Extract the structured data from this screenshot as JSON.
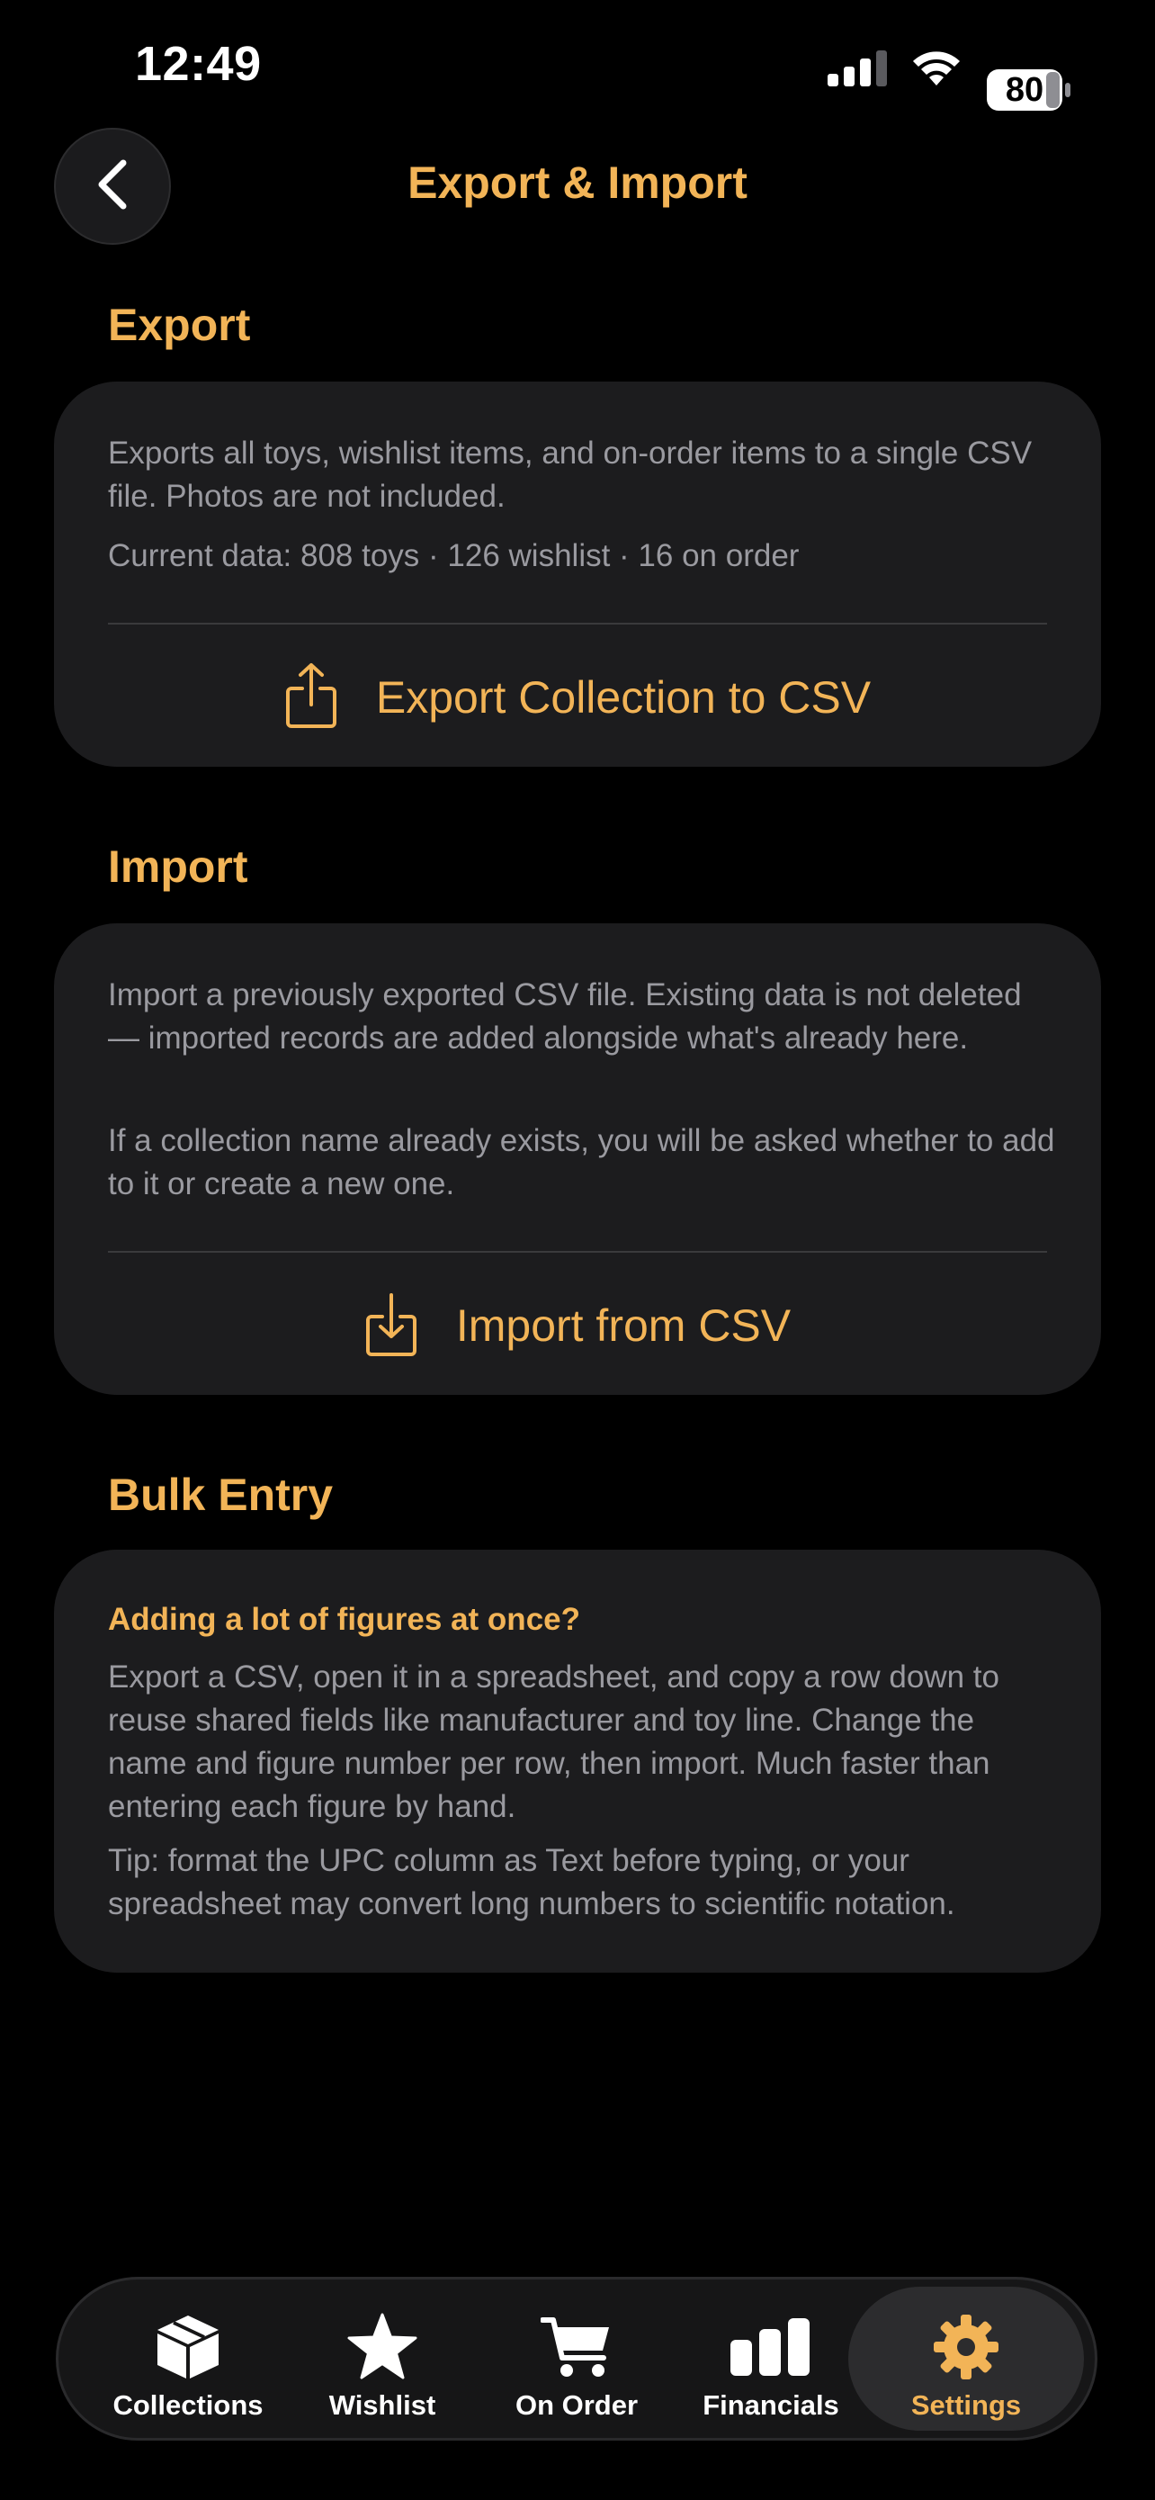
{
  "status_bar": {
    "time": "12:49",
    "battery": "80"
  },
  "header": {
    "title": "Export & Import"
  },
  "colors": {
    "accent": "#f2b457",
    "background": "#000000",
    "card": "#1c1c1e",
    "secondary_text": "#9a9aa0"
  },
  "export": {
    "heading": "Export",
    "description": "Exports all toys, wishlist items, and on-order items to a single CSV file. Photos are not included.",
    "current_data": "Current data: 808 toys · 126 wishlist · 16 on order",
    "action_label": "Export Collection to CSV",
    "action_icon": "share-icon"
  },
  "import": {
    "heading": "Import",
    "description": "Import a previously exported CSV file. Existing data is not deleted — imported records are added alongside what's already here.",
    "note": "If a collection name already exists, you will be asked whether to add to it or create a new one.",
    "action_label": "Import from CSV",
    "action_icon": "download-tray-icon"
  },
  "bulk_entry": {
    "heading": "Bulk Entry",
    "tip_heading": "Adding a lot of figures at once?",
    "body": "Export a CSV, open it in a spreadsheet, and copy a row down to reuse shared fields like manufacturer and toy line. Change the name and figure number per row, then import. Much faster than entering each figure by hand.",
    "tip": "Tip: format the UPC column as Text before typing, or your spreadsheet may convert long numbers to scientific notation."
  },
  "tab_bar": {
    "items": [
      {
        "label": "Collections",
        "icon": "box-icon"
      },
      {
        "label": "Wishlist",
        "icon": "star-icon"
      },
      {
        "label": "On Order",
        "icon": "cart-icon"
      },
      {
        "label": "Financials",
        "icon": "bar-chart-icon"
      },
      {
        "label": "Settings",
        "icon": "gear-icon",
        "active": true
      }
    ]
  }
}
